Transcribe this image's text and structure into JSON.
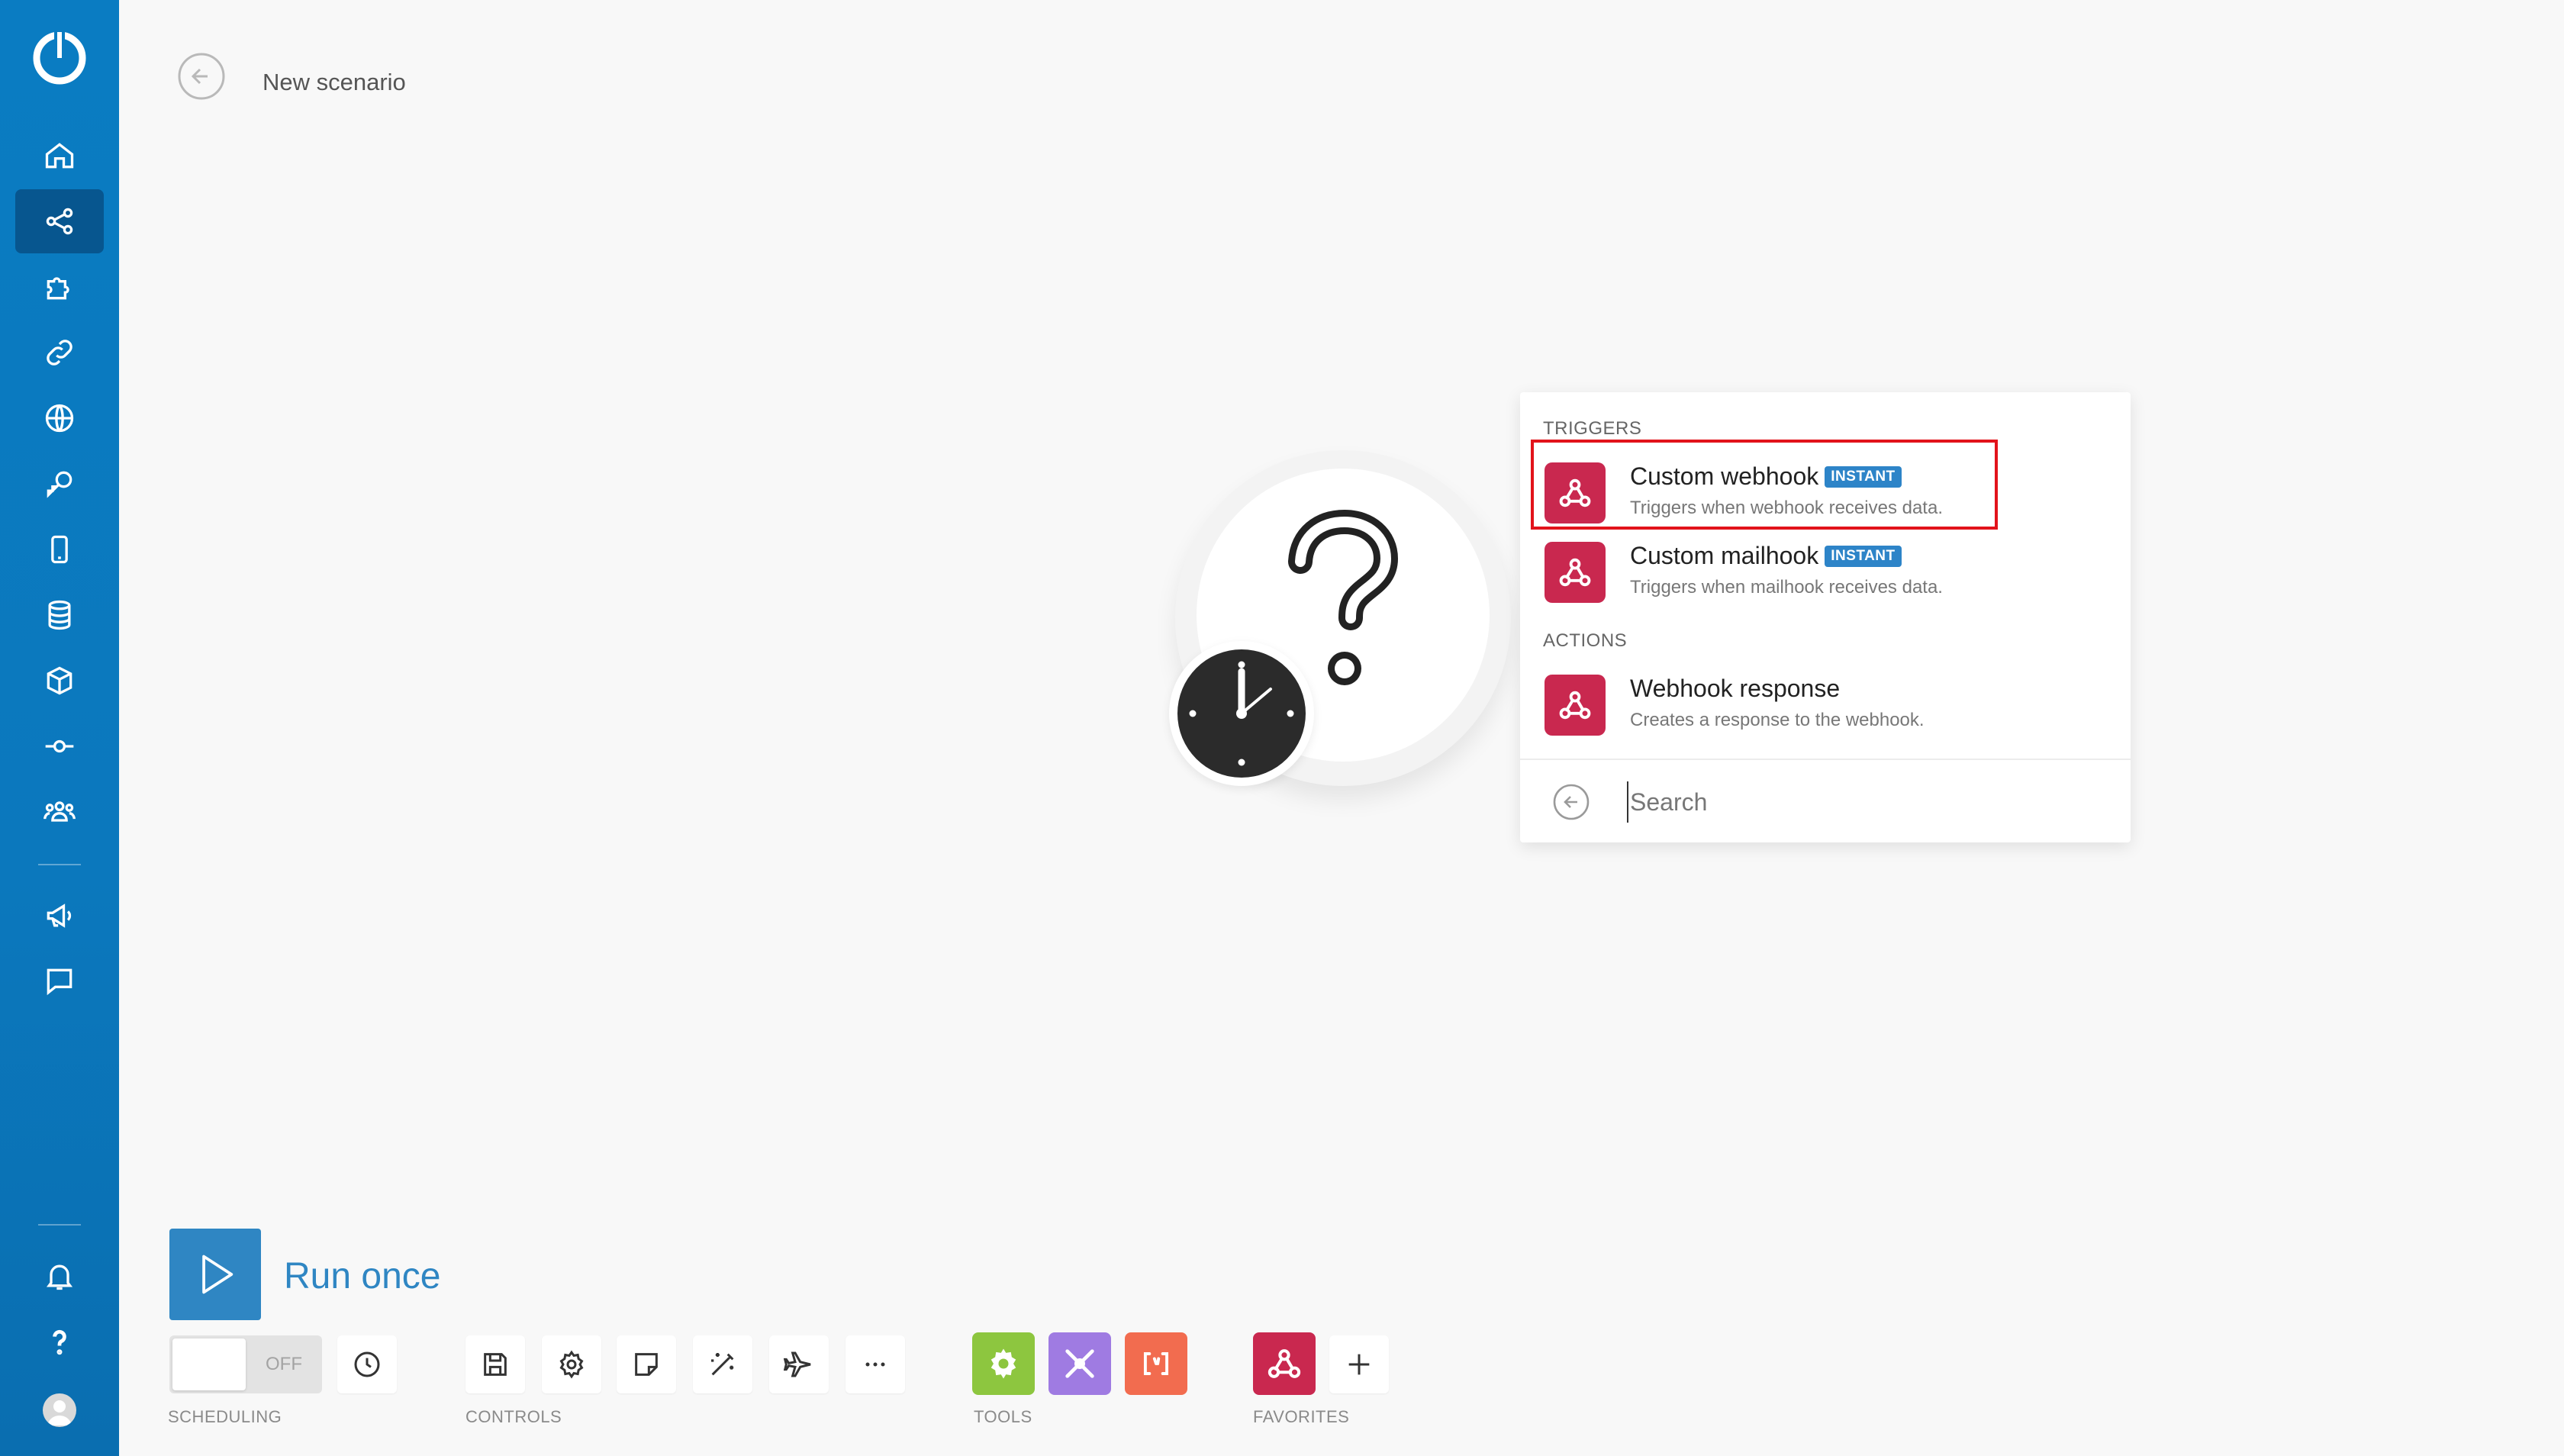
{
  "app": {
    "title": "New scenario"
  },
  "sidebar": {
    "items": [
      {
        "icon": "home-icon"
      },
      {
        "icon": "scenarios-icon",
        "active": true
      },
      {
        "icon": "templates-icon"
      },
      {
        "icon": "connections-icon"
      },
      {
        "icon": "webhooks-icon"
      },
      {
        "icon": "keys-icon"
      },
      {
        "icon": "devices-icon"
      },
      {
        "icon": "data-stores-icon"
      },
      {
        "icon": "data-structures-icon"
      },
      {
        "icon": "custom-apps-icon"
      },
      {
        "icon": "team-icon"
      },
      {
        "icon": "announcements-icon"
      },
      {
        "icon": "feedback-icon"
      },
      {
        "icon": "notifications-icon"
      },
      {
        "icon": "help-icon"
      }
    ]
  },
  "popup": {
    "triggers_label": "TRIGGERS",
    "actions_label": "ACTIONS",
    "items": [
      {
        "title": "Custom webhook",
        "badge": "INSTANT",
        "desc": "Triggers when webhook receives data."
      },
      {
        "title": "Custom mailhook",
        "badge": "INSTANT",
        "desc": "Triggers when mailhook receives data."
      },
      {
        "title": "Webhook response",
        "desc": "Creates a response to the webhook."
      }
    ],
    "search_placeholder": "Search"
  },
  "bottom": {
    "run_once": "Run once",
    "toggle_state": "OFF",
    "scheduling_label": "SCHEDULING",
    "controls_label": "CONTROLS",
    "tools_label": "TOOLS",
    "favorites_label": "FAVORITES",
    "controls": [
      "save-icon",
      "settings-icon",
      "notes-icon",
      "auto-align-icon",
      "explain-flow-icon",
      "more-icon"
    ],
    "tools": [
      {
        "name": "tools-gear-app",
        "color": "#8dc63f"
      },
      {
        "name": "tools-flow-control-app",
        "color": "#9f7be2"
      },
      {
        "name": "tools-text-parser-app",
        "color": "#f26c4f"
      }
    ],
    "favorites": [
      {
        "name": "webhooks-app",
        "color": "#c9284f"
      }
    ]
  },
  "colors": {
    "sidebar": "#0b78bd",
    "accent": "#2f86c3",
    "webhook": "#c9284f",
    "highlight": "#e2131b"
  }
}
